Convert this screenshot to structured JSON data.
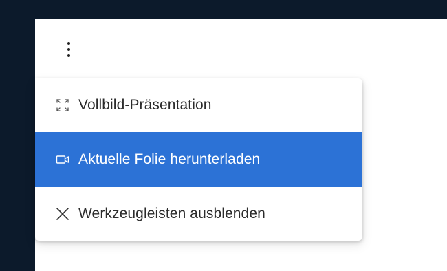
{
  "colors": {
    "frame": "#0c1a2b",
    "highlight": "#2c72d6",
    "text": "#2b2b2b",
    "background": "#ffffff"
  },
  "more_button": {
    "icon": "more-vertical-icon"
  },
  "menu": {
    "items": [
      {
        "label": "Vollbild-Präsentation",
        "icon": "fullscreen-icon",
        "active": false
      },
      {
        "label": "Aktuelle Folie herunterladen",
        "icon": "camera-icon",
        "active": true
      },
      {
        "label": "Werkzeugleisten ausblenden",
        "icon": "close-icon",
        "active": false
      }
    ]
  }
}
